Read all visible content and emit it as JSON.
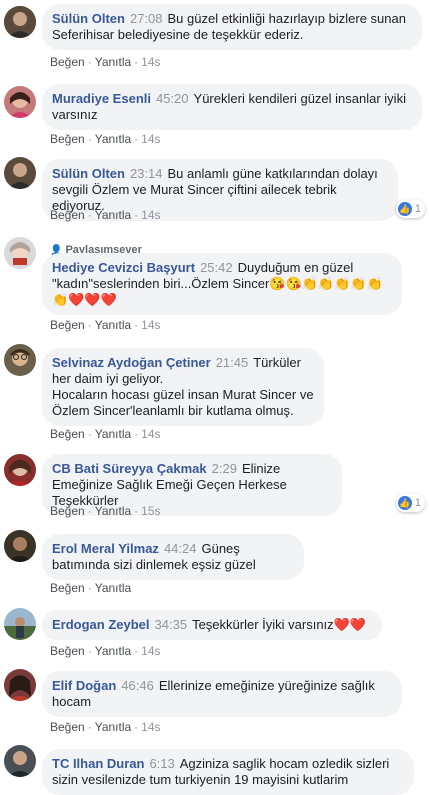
{
  "action_like": "Beğen",
  "action_reply": "Yanıtla",
  "action_sep": "·",
  "comments": [
    {
      "author": "Sülün Olten",
      "time": "27:08",
      "text": "Bu güzel etkinliği hazırlayıp bizlere sunan Seferihisar belediyesine de teşekkür ederiz.",
      "age": "14s"
    },
    {
      "author": "Muradiye Esenli",
      "time": "45:20",
      "text": "Yürekleri kendileri güzel insanlar iyiki varsınız",
      "age": "14s"
    },
    {
      "author": "Sülün Olten",
      "time": "23:14",
      "text": "Bu anlamlı güne katkılarından dolayı sevgili Özlem ve Murat Sincer çiftini ailecek tebrik ediyoruz.",
      "age": "14s",
      "reactions": "1"
    },
    {
      "badge": "Paylaşımsever",
      "author": "Hediye Cevizci Başyurt",
      "time": "25:42",
      "text": "Duyduğum en güzel \"kadın\"seslerinden biri...Özlem Sincer",
      "emoji": "😘😘👏👏👏👏👏👏❤️❤️❤️",
      "age": "14s"
    },
    {
      "author": "Selvinaz Aydoğan Çetiner",
      "time": "21:45",
      "text": "Türküler her daim iyi geliyor.",
      "text2": "Hocaların hocası güzel insan Murat Sincer ve Özlem Sincer'leanlamlı bir kutlama olmuş.",
      "age": "14s"
    },
    {
      "author": "CB Bati Süreyya Çakmak",
      "time": "2:29",
      "text": "Elinize Emeğinize Sağlık Emeği Geçen Herkese Teşekkürler",
      "age": "15s",
      "reactions": "1"
    },
    {
      "author": "Erol Meral Yilmaz",
      "time": "44:24",
      "text": "Güneş batımında sizi dinlemek eşsiz güzel",
      "age": ""
    },
    {
      "author": "Erdogan Zeybel",
      "time": "34:35",
      "text": "Teşekkürler İyiki varsınız",
      "emoji": "❤️❤️",
      "age": "14s"
    },
    {
      "author": "Elif Doğan",
      "time": "46:46",
      "text": "Ellerinize emeğinize yüreğinize sağlık hocam",
      "age": "14s"
    },
    {
      "author": "TC Ilhan Duran",
      "time": "6:13",
      "text": "Agziniza saglik hocam ozledik sizleri sizin vesilenizde tum turkiyenin 19 mayisini kutlarim",
      "age": ""
    }
  ],
  "colors": {
    "author": "#385898",
    "bubble": "#f2f3f5",
    "meta": "#90949c",
    "like": "#3578e5"
  }
}
